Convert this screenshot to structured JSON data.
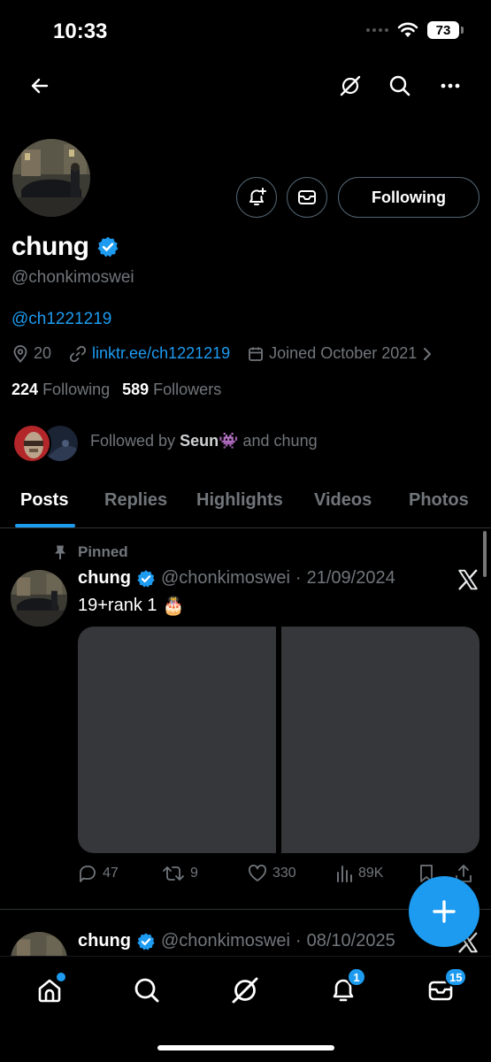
{
  "status_bar": {
    "time": "10:33",
    "battery": "73"
  },
  "header": {
    "back_icon": "arrow-left-icon",
    "grok_icon": "grok-icon",
    "search_icon": "search-icon",
    "more_icon": "more-horizontal-icon"
  },
  "profile": {
    "name": "chung",
    "handle": "@chonkimoswei",
    "bio": "@ch1221219",
    "location": "20",
    "website": "linktr.ee/ch1221219",
    "joined": "Joined October 2021",
    "following_count": "224",
    "following_label": "Following",
    "followers_count": "589",
    "followers_label": "Followers",
    "follow_button": "Following",
    "followed_by_prefix": "Followed by",
    "followed_by_name1": "Seun",
    "followed_by_emoji": "👾",
    "followed_by_suffix": "and chung"
  },
  "tabs": [
    "Posts",
    "Replies",
    "Highlights",
    "Videos",
    "Photos"
  ],
  "posts": [
    {
      "pinned_label": "Pinned",
      "name": "chung",
      "handle": "@chonkimoswei",
      "separator": "·",
      "date": "21/09/2024",
      "text": "19+rank 1",
      "emoji": "🎂",
      "replies": "47",
      "reposts": "9",
      "likes": "330",
      "views": "89K"
    },
    {
      "name": "chung",
      "handle": "@chonkimoswei",
      "separator": "·",
      "date": "08/10/2025"
    }
  ],
  "bottom_nav": {
    "notifications_badge": "1",
    "messages_badge": "15"
  },
  "colors": {
    "accent": "#1d9bf0",
    "background": "#000000",
    "muted": "#71767b",
    "border": "#2f3336"
  }
}
